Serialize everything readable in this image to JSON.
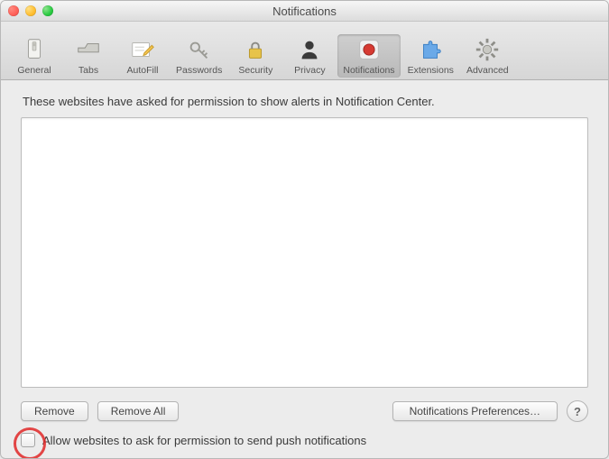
{
  "window": {
    "title": "Notifications"
  },
  "toolbar": {
    "items": [
      {
        "label": "General"
      },
      {
        "label": "Tabs"
      },
      {
        "label": "AutoFill"
      },
      {
        "label": "Passwords"
      },
      {
        "label": "Security"
      },
      {
        "label": "Privacy"
      },
      {
        "label": "Notifications",
        "selected": true
      },
      {
        "label": "Extensions"
      },
      {
        "label": "Advanced"
      }
    ]
  },
  "main": {
    "description": "These websites have asked for permission to show alerts in Notification Center.",
    "websites": []
  },
  "buttons": {
    "remove": "Remove",
    "remove_all": "Remove All",
    "prefs": "Notifications Preferences…",
    "help": "?"
  },
  "checkbox": {
    "allow_label": "Allow websites to ask for permission to send push notifications",
    "allow_checked": false
  }
}
